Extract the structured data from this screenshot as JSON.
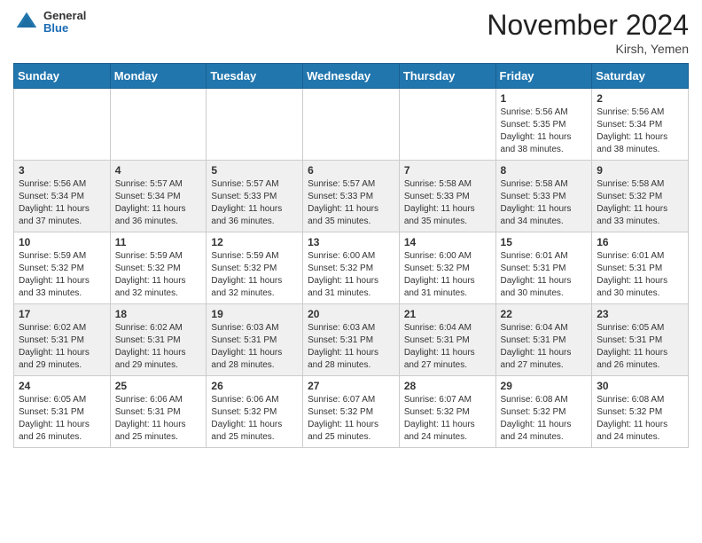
{
  "header": {
    "logo_general": "General",
    "logo_blue": "Blue",
    "month_title": "November 2024",
    "location": "Kirsh, Yemen"
  },
  "weekdays": [
    "Sunday",
    "Monday",
    "Tuesday",
    "Wednesday",
    "Thursday",
    "Friday",
    "Saturday"
  ],
  "weeks": [
    [
      {
        "day": "",
        "info": ""
      },
      {
        "day": "",
        "info": ""
      },
      {
        "day": "",
        "info": ""
      },
      {
        "day": "",
        "info": ""
      },
      {
        "day": "",
        "info": ""
      },
      {
        "day": "1",
        "info": "Sunrise: 5:56 AM\nSunset: 5:35 PM\nDaylight: 11 hours\nand 38 minutes."
      },
      {
        "day": "2",
        "info": "Sunrise: 5:56 AM\nSunset: 5:34 PM\nDaylight: 11 hours\nand 38 minutes."
      }
    ],
    [
      {
        "day": "3",
        "info": "Sunrise: 5:56 AM\nSunset: 5:34 PM\nDaylight: 11 hours\nand 37 minutes."
      },
      {
        "day": "4",
        "info": "Sunrise: 5:57 AM\nSunset: 5:34 PM\nDaylight: 11 hours\nand 36 minutes."
      },
      {
        "day": "5",
        "info": "Sunrise: 5:57 AM\nSunset: 5:33 PM\nDaylight: 11 hours\nand 36 minutes."
      },
      {
        "day": "6",
        "info": "Sunrise: 5:57 AM\nSunset: 5:33 PM\nDaylight: 11 hours\nand 35 minutes."
      },
      {
        "day": "7",
        "info": "Sunrise: 5:58 AM\nSunset: 5:33 PM\nDaylight: 11 hours\nand 35 minutes."
      },
      {
        "day": "8",
        "info": "Sunrise: 5:58 AM\nSunset: 5:33 PM\nDaylight: 11 hours\nand 34 minutes."
      },
      {
        "day": "9",
        "info": "Sunrise: 5:58 AM\nSunset: 5:32 PM\nDaylight: 11 hours\nand 33 minutes."
      }
    ],
    [
      {
        "day": "10",
        "info": "Sunrise: 5:59 AM\nSunset: 5:32 PM\nDaylight: 11 hours\nand 33 minutes."
      },
      {
        "day": "11",
        "info": "Sunrise: 5:59 AM\nSunset: 5:32 PM\nDaylight: 11 hours\nand 32 minutes."
      },
      {
        "day": "12",
        "info": "Sunrise: 5:59 AM\nSunset: 5:32 PM\nDaylight: 11 hours\nand 32 minutes."
      },
      {
        "day": "13",
        "info": "Sunrise: 6:00 AM\nSunset: 5:32 PM\nDaylight: 11 hours\nand 31 minutes."
      },
      {
        "day": "14",
        "info": "Sunrise: 6:00 AM\nSunset: 5:32 PM\nDaylight: 11 hours\nand 31 minutes."
      },
      {
        "day": "15",
        "info": "Sunrise: 6:01 AM\nSunset: 5:31 PM\nDaylight: 11 hours\nand 30 minutes."
      },
      {
        "day": "16",
        "info": "Sunrise: 6:01 AM\nSunset: 5:31 PM\nDaylight: 11 hours\nand 30 minutes."
      }
    ],
    [
      {
        "day": "17",
        "info": "Sunrise: 6:02 AM\nSunset: 5:31 PM\nDaylight: 11 hours\nand 29 minutes."
      },
      {
        "day": "18",
        "info": "Sunrise: 6:02 AM\nSunset: 5:31 PM\nDaylight: 11 hours\nand 29 minutes."
      },
      {
        "day": "19",
        "info": "Sunrise: 6:03 AM\nSunset: 5:31 PM\nDaylight: 11 hours\nand 28 minutes."
      },
      {
        "day": "20",
        "info": "Sunrise: 6:03 AM\nSunset: 5:31 PM\nDaylight: 11 hours\nand 28 minutes."
      },
      {
        "day": "21",
        "info": "Sunrise: 6:04 AM\nSunset: 5:31 PM\nDaylight: 11 hours\nand 27 minutes."
      },
      {
        "day": "22",
        "info": "Sunrise: 6:04 AM\nSunset: 5:31 PM\nDaylight: 11 hours\nand 27 minutes."
      },
      {
        "day": "23",
        "info": "Sunrise: 6:05 AM\nSunset: 5:31 PM\nDaylight: 11 hours\nand 26 minutes."
      }
    ],
    [
      {
        "day": "24",
        "info": "Sunrise: 6:05 AM\nSunset: 5:31 PM\nDaylight: 11 hours\nand 26 minutes."
      },
      {
        "day": "25",
        "info": "Sunrise: 6:06 AM\nSunset: 5:31 PM\nDaylight: 11 hours\nand 25 minutes."
      },
      {
        "day": "26",
        "info": "Sunrise: 6:06 AM\nSunset: 5:32 PM\nDaylight: 11 hours\nand 25 minutes."
      },
      {
        "day": "27",
        "info": "Sunrise: 6:07 AM\nSunset: 5:32 PM\nDaylight: 11 hours\nand 25 minutes."
      },
      {
        "day": "28",
        "info": "Sunrise: 6:07 AM\nSunset: 5:32 PM\nDaylight: 11 hours\nand 24 minutes."
      },
      {
        "day": "29",
        "info": "Sunrise: 6:08 AM\nSunset: 5:32 PM\nDaylight: 11 hours\nand 24 minutes."
      },
      {
        "day": "30",
        "info": "Sunrise: 6:08 AM\nSunset: 5:32 PM\nDaylight: 11 hours\nand 24 minutes."
      }
    ]
  ]
}
